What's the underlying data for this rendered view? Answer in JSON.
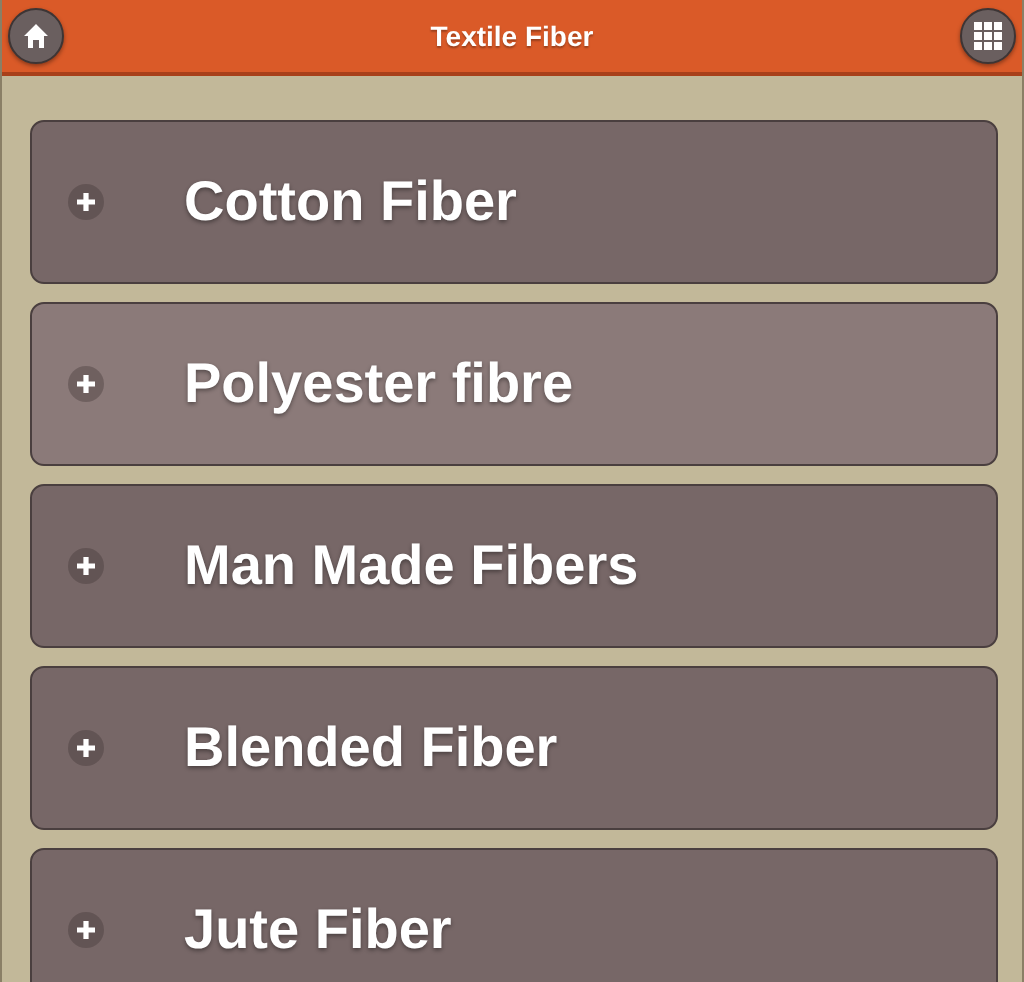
{
  "header": {
    "title": "Textile Fiber"
  },
  "items": [
    {
      "label": "Cotton Fiber",
      "selected": false
    },
    {
      "label": "Polyester fibre",
      "selected": true
    },
    {
      "label": "Man Made Fibers",
      "selected": false
    },
    {
      "label": "Blended Fiber",
      "selected": false
    },
    {
      "label": "Jute Fiber",
      "selected": false
    }
  ]
}
